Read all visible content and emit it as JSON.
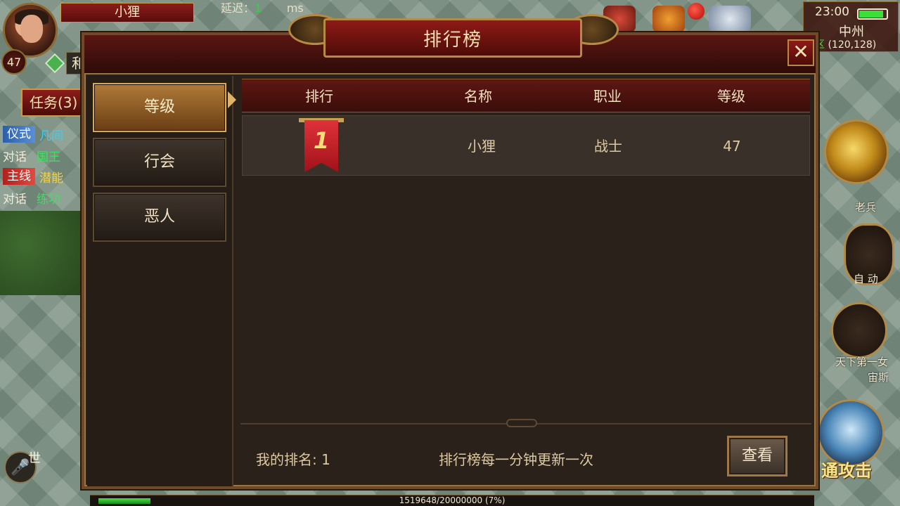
{
  "hud": {
    "player_name": "小狸",
    "player_level": "47",
    "latency_label": "延迟：",
    "latency_value": "1",
    "latency_unit": "ms",
    "guild_chip": "和",
    "quest_button": "任务(3)",
    "quests": [
      {
        "tag": "仪式",
        "tag_color": "blue",
        "title": "凡间"
      },
      {
        "action": "对话",
        "target": "国王"
      },
      {
        "tag": "主线",
        "tag_color": "red",
        "title": "潜能"
      },
      {
        "action": "对话",
        "target": "练功"
      }
    ],
    "chat_channel": "世",
    "time": "23:00",
    "battery_level": 0.9,
    "map_name": "中州",
    "zone": "全区",
    "coords": "(120,128)",
    "npc_laobing": "老兵",
    "auto_label": "自 动",
    "npc_tianxia": "天下第一女",
    "npc_zhousi": "宙斯",
    "attack_label": "通攻击",
    "exp_text": "1519648/20000000 (7%)",
    "exp_progress": 0.07
  },
  "dialog": {
    "title": "排行榜",
    "close_icon": "close-icon",
    "categories": [
      {
        "label": "等级",
        "active": true
      },
      {
        "label": "行会",
        "active": false
      },
      {
        "label": "恶人",
        "active": false
      }
    ],
    "columns": [
      "排行",
      "名称",
      "职业",
      "等级"
    ],
    "rows": [
      {
        "rank": "1",
        "name": "小狸",
        "class": "战士",
        "level": "47"
      }
    ],
    "my_rank": "我的排名: 1",
    "update_note": "排行榜每一分钟更新一次",
    "view_button": "查看"
  },
  "colors": {
    "accent_gold": "#b48a46",
    "header_red": "#5e1712",
    "panel_bg": "#2b211b"
  }
}
